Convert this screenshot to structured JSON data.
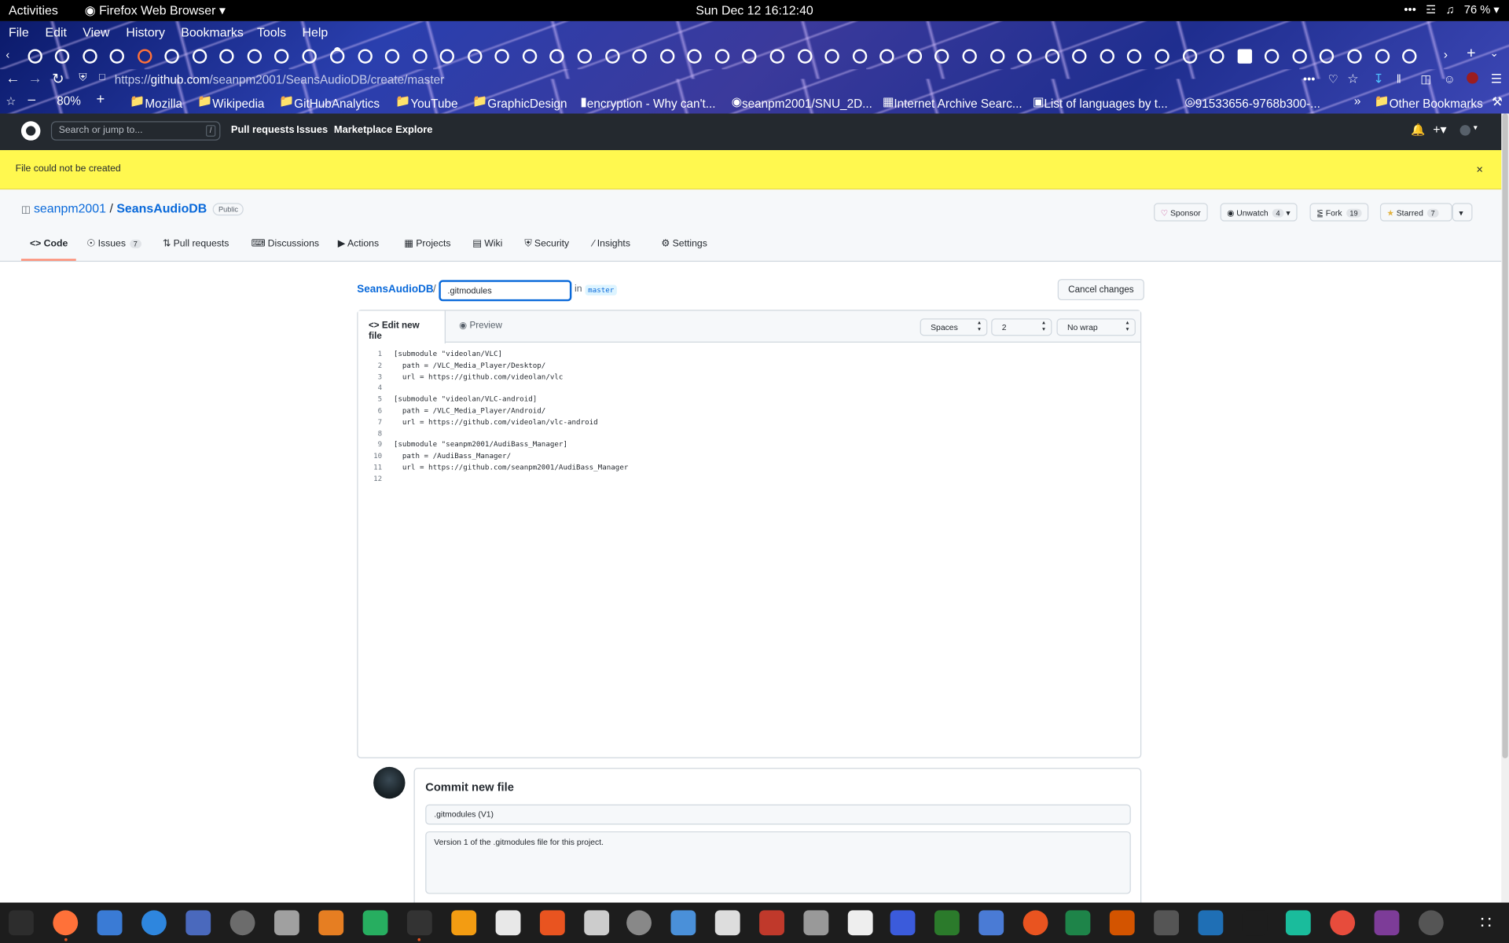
{
  "system_bar": {
    "activities": "Activities",
    "app_name": "Firefox Web Browser",
    "clock": "Sun Dec 12  16:12:40",
    "battery": "76 %"
  },
  "browser": {
    "menu": [
      "File",
      "Edit",
      "View",
      "History",
      "Bookmarks",
      "Tools",
      "Help"
    ],
    "url_prefix": "https://",
    "url_host": "github.com",
    "url_path": "/seanpm2001/SeansAudioDB/create/master",
    "zoom": "80%",
    "bookmarks": [
      "Mozilla",
      "Wikipedia",
      "GitHubAnalytics",
      "YouTube",
      "GraphicDesign",
      "encryption - Why can't...",
      "seanpm2001/SNU_2D...",
      "Internet Archive Searc...",
      "List of languages by t...",
      "91533656-9768b300-...",
      "Other Bookmarks"
    ]
  },
  "github": {
    "search_placeholder": "Search or jump to...",
    "search_key": "/",
    "nav": [
      "Pull requests",
      "Issues",
      "Marketplace",
      "Explore"
    ]
  },
  "flash": {
    "message": "File could not be created",
    "close": "×"
  },
  "repo": {
    "owner": "seanpm2001",
    "separator": "/",
    "name": "SeansAudioDB",
    "visibility": "Public",
    "sponsor": "Sponsor",
    "unwatch": "Unwatch",
    "watch_count": "4",
    "fork": "Fork",
    "fork_count": "19",
    "starred": "Starred",
    "star_count": "7",
    "tabs": [
      {
        "label": "Code"
      },
      {
        "label": "Issues",
        "count": "7"
      },
      {
        "label": "Pull requests"
      },
      {
        "label": "Discussions"
      },
      {
        "label": "Actions"
      },
      {
        "label": "Projects"
      },
      {
        "label": "Wiki"
      },
      {
        "label": "Security"
      },
      {
        "label": "Insights"
      },
      {
        "label": "Settings"
      }
    ]
  },
  "editor": {
    "repo_link": "SeansAudioDB",
    "slash": "/",
    "filename": ".gitmodules",
    "in": "in",
    "branch": "master",
    "cancel": "Cancel changes",
    "edit_tab": "Edit new file",
    "preview_tab": "Preview",
    "indent_mode": "Spaces",
    "indent_size": "2",
    "wrap_mode": "No wrap",
    "lines": [
      "[submodule \"videolan/VLC]",
      "  path = /VLC_Media_Player/Desktop/",
      "  url = https://github.com/videolan/vlc",
      "",
      "[submodule \"videolan/VLC-android]",
      "  path = /VLC_Media_Player/Android/",
      "  url = https://github.com/videolan/vlc-android",
      "",
      "[submodule \"seanpm2001/AudiBass_Manager]",
      "  path = /AudiBass_Manager/",
      "  url = https://github.com/seanpm2001/AudiBass_Manager",
      ""
    ]
  },
  "commit": {
    "title": "Commit new file",
    "summary": ".gitmodules (V1)",
    "description": "Version 1 of the .gitmodules file for this project."
  }
}
